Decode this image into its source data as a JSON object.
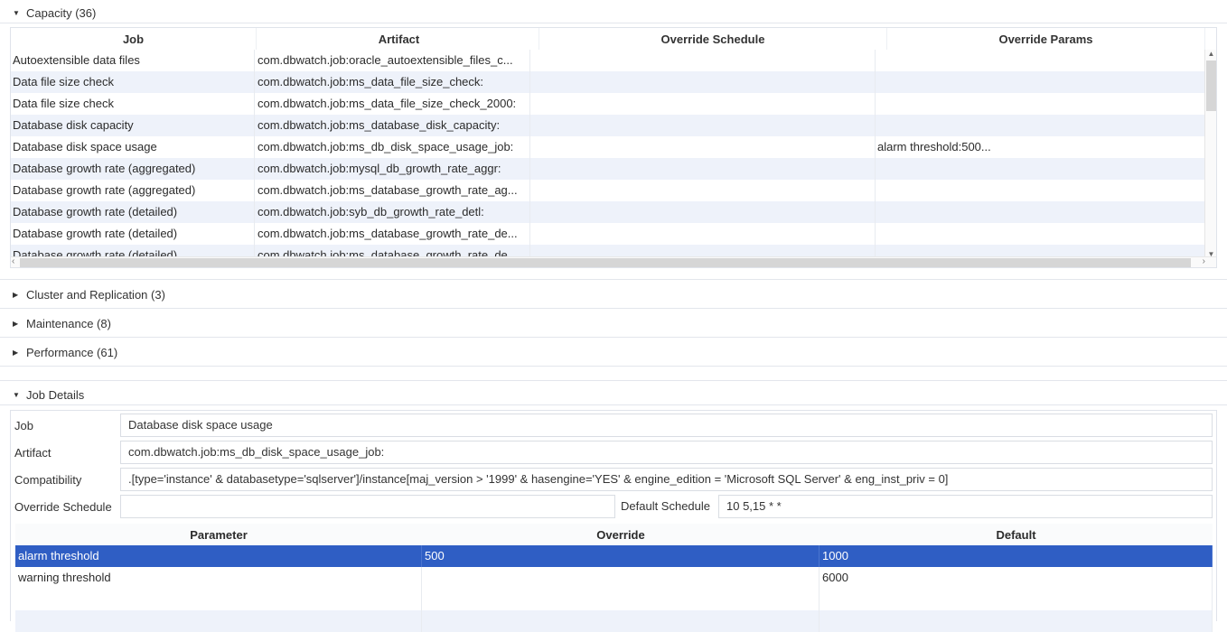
{
  "sections": {
    "capacity": "Capacity (36)",
    "cluster": "Cluster and Replication (3)",
    "maintenance": "Maintenance (8)",
    "performance": "Performance (61)",
    "job_details": "Job Details"
  },
  "capacity_table": {
    "headers": [
      "Job",
      "Artifact",
      "Override Schedule",
      "Override Params"
    ],
    "rows": [
      [
        "Autoextensible data files",
        "com.dbwatch.job:oracle_autoextensible_files_c...",
        "",
        ""
      ],
      [
        "Data file size check",
        "com.dbwatch.job:ms_data_file_size_check:",
        "",
        ""
      ],
      [
        "Data file size check",
        "com.dbwatch.job:ms_data_file_size_check_2000:",
        "",
        ""
      ],
      [
        "Database disk capacity",
        "com.dbwatch.job:ms_database_disk_capacity:",
        "",
        ""
      ],
      [
        "Database disk space usage",
        "com.dbwatch.job:ms_db_disk_space_usage_job:",
        "",
        "alarm threshold:500..."
      ],
      [
        "Database growth rate (aggregated)",
        "com.dbwatch.job:mysql_db_growth_rate_aggr:",
        "",
        ""
      ],
      [
        "Database growth rate (aggregated)",
        "com.dbwatch.job:ms_database_growth_rate_ag...",
        "",
        ""
      ],
      [
        "Database growth rate (detailed)",
        "com.dbwatch.job:syb_db_growth_rate_detl:",
        "",
        ""
      ],
      [
        "Database growth rate (detailed)",
        "com.dbwatch.job:ms_database_growth_rate_de...",
        "",
        ""
      ],
      [
        "Database growth rate (detailed)",
        "com.dbwatch.job:ms_database_growth_rate_de...",
        "",
        ""
      ]
    ]
  },
  "details": {
    "job_label": "Job",
    "job_value": "Database disk space usage",
    "artifact_label": "Artifact",
    "artifact_value": "com.dbwatch.job:ms_db_disk_space_usage_job:",
    "compat_label": "Compatibility",
    "compat_value": ".[type='instance' & databasetype='sqlserver']/instance[maj_version > '1999' & hasengine='YES' & engine_edition = 'Microsoft SQL Server' & eng_inst_priv = 0]",
    "override_schedule_label": "Override Schedule",
    "override_schedule_value": "",
    "default_schedule_label": "Default Schedule",
    "default_schedule_value": "10 5,15 * *"
  },
  "param_table": {
    "headers": [
      "Parameter",
      "Override",
      "Default"
    ],
    "rows": [
      [
        "alarm threshold",
        "500",
        "1000"
      ],
      [
        "warning threshold",
        "",
        "6000"
      ],
      [
        "",
        "",
        ""
      ],
      [
        "",
        "",
        ""
      ]
    ]
  }
}
